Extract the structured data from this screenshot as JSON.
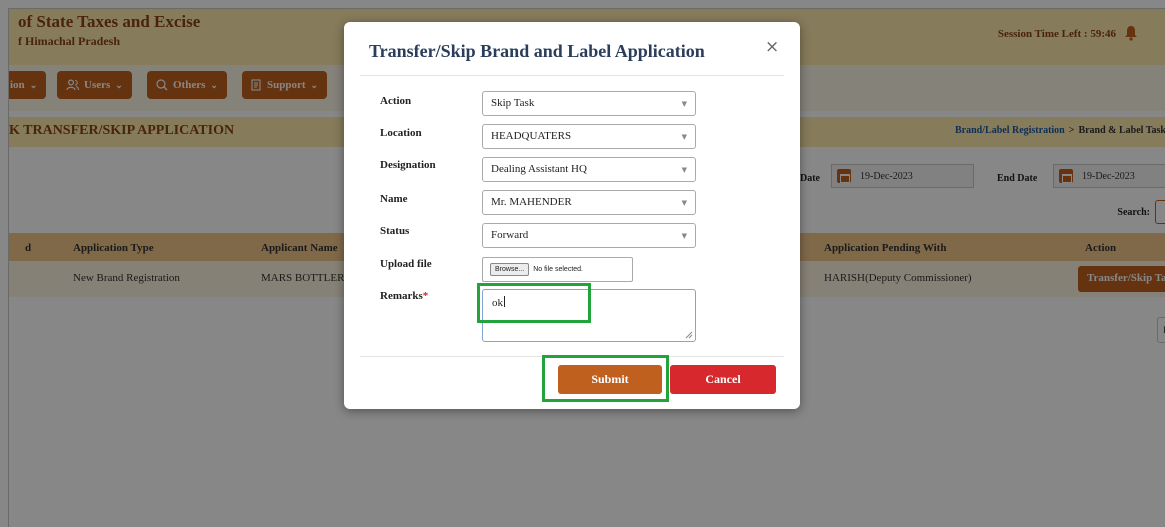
{
  "header": {
    "org_line1": "of State Taxes and Excise",
    "org_line2": "f Himachal Pradesh",
    "session_text": "Session Time Left : 59:46",
    "bell_icon": "bell-icon"
  },
  "nav": {
    "items": [
      {
        "label": "ion",
        "icon": "",
        "chevron": "chevron-down-icon"
      },
      {
        "label": "Users",
        "icon": "users-icon",
        "chevron": "chevron-down-icon"
      },
      {
        "label": "Others",
        "icon": "search-circle-icon",
        "chevron": "chevron-down-icon"
      },
      {
        "label": "Support",
        "icon": "document-icon",
        "chevron": "chevron-down-icon"
      }
    ]
  },
  "page": {
    "title": "K TRANSFER/SKIP APPLICATION",
    "breadcrumb_link": "Brand/Label Registration",
    "breadcrumb_sep": ">",
    "breadcrumb_current": "Brand & Label Task"
  },
  "filters": {
    "start_label": "Date",
    "start_value": "19-Dec-2023",
    "end_label": "End Date",
    "end_value": "19-Dec-2023",
    "search_label": "Search:"
  },
  "table": {
    "headers": [
      "d",
      "Application Type",
      "Applicant Name",
      "Application Pending With",
      "Action"
    ],
    "rows": [
      {
        "type": "New Brand Registration",
        "applicant": "MARS BOTTLER",
        "pending_with": "HARISH(Deputy Commissioner)",
        "action": "Transfer/Skip Task"
      }
    ],
    "pager_text": "P"
  },
  "modal": {
    "title": "Transfer/Skip Brand and Label Application",
    "close_glyph": "×",
    "fields": {
      "action_label": "Action",
      "action_value": "Skip Task",
      "location_label": "Location",
      "location_value": "HEADQUATERS",
      "designation_label": "Designation",
      "designation_value": "Dealing Assistant HQ",
      "name_label": "Name",
      "name_value": "Mr. MAHENDER",
      "status_label": "Status",
      "status_value": "Forward",
      "upload_label": "Upload file",
      "browse_label": "Browse...",
      "file_status": "No file selected.",
      "remarks_label": "Remarks",
      "remarks_required": "*",
      "remarks_value": "ok"
    },
    "submit_label": "Submit",
    "cancel_label": "Cancel"
  },
  "colors": {
    "header_bg": "#fde9ad",
    "brand_brown": "#8a4514",
    "primary_button": "#c0601f",
    "cancel_button": "#d7292d",
    "highlight": "#22a33b",
    "modal_title": "#2a3d5a"
  }
}
